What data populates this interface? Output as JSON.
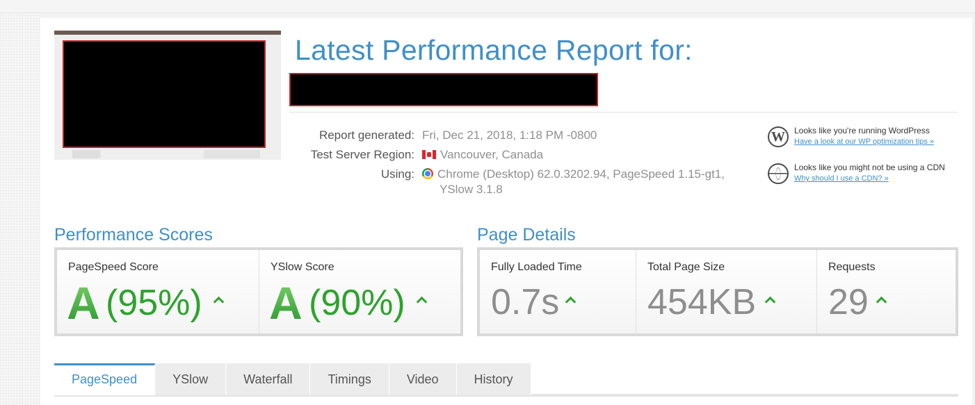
{
  "report": {
    "title": "Latest Performance Report for:",
    "meta": {
      "generated_label": "Report generated:",
      "generated_value": "Fri, Dec 21, 2018, 1:18 PM -0800",
      "region_label": "Test Server Region:",
      "region_value": "Vancouver, Canada",
      "using_label": "Using:",
      "using_value_line1": "Chrome (Desktop) 62.0.3202.94, PageSpeed 1.15-gt1,",
      "using_value_line2": "YSlow 3.1.8"
    },
    "tips": [
      {
        "icon": "wordpress-icon",
        "text": "Looks like you're running WordPress",
        "link": "Have a look at our WP optimization tips »"
      },
      {
        "icon": "globe-icon",
        "text": "Looks like you might not be using a CDN",
        "link": "Why should I use a CDN? »"
      }
    ]
  },
  "performance_scores": {
    "title": "Performance Scores",
    "pagespeed": {
      "label": "PageSpeed Score",
      "grade": "A",
      "percent": "(95%)"
    },
    "yslow": {
      "label": "YSlow Score",
      "grade": "A",
      "percent": "(90%)"
    }
  },
  "page_details": {
    "title": "Page Details",
    "fully_loaded": {
      "label": "Fully Loaded Time",
      "value": "0.7s"
    },
    "page_size": {
      "label": "Total Page Size",
      "value": "454KB"
    },
    "requests": {
      "label": "Requests",
      "value": "29"
    }
  },
  "tabs": [
    "PageSpeed",
    "YSlow",
    "Waterfall",
    "Timings",
    "Video",
    "History"
  ],
  "active_tab": "PageSpeed",
  "colors": {
    "accent": "#3f8fc9",
    "good": "#2da32d",
    "redaction_border": "#c0272d"
  }
}
